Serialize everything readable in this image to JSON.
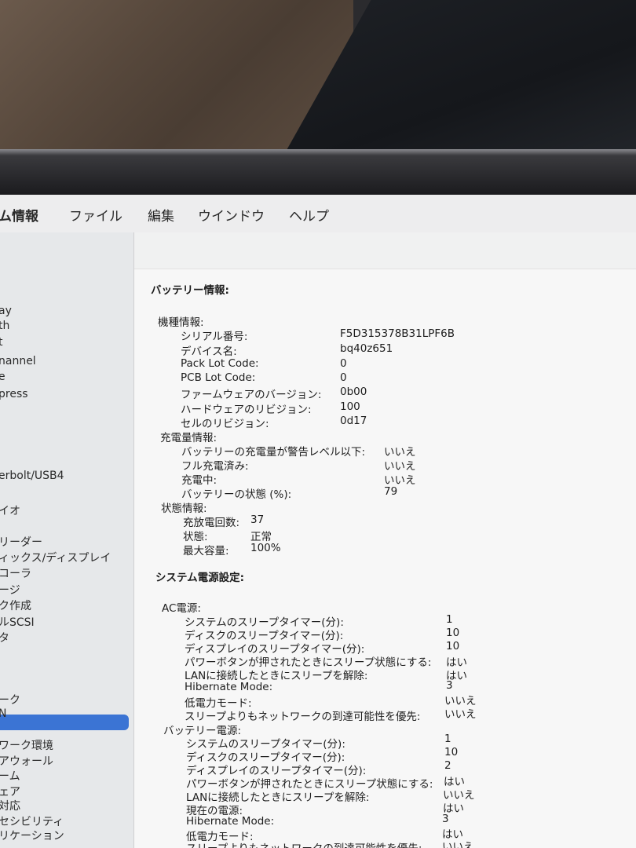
{
  "menubar": {
    "app": "ム情報",
    "file": "ファイル",
    "edit": "編集",
    "window": "ウインドウ",
    "help": "ヘルプ"
  },
  "sidebar": {
    "items": [
      "ay",
      "th",
      "t",
      "nannel",
      "e",
      "press",
      "erbolt/USB4",
      "イオ",
      "リーダー",
      "ィックス/ディスプレイ",
      "コーラ",
      "ージ",
      "ク作成",
      "ルSCSI",
      "タ",
      "ーク",
      "N",
      "ワーク環境",
      "アウォール",
      "ーム",
      "ェア",
      "対応",
      "セシビリティ",
      "リケーション"
    ]
  },
  "battery": {
    "title": "バッテリー情報:",
    "model_header": "機種情報:",
    "serial_label": "シリアル番号:",
    "serial_value": "F5D315378B31LPF6B",
    "device_label": "デバイス名:",
    "device_value": "bq40z651",
    "pack_lot_label": "Pack Lot Code:",
    "pack_lot_value": "0",
    "pcb_lot_label": "PCB Lot Code:",
    "pcb_lot_value": "0",
    "firmware_label": "ファームウェアのバージョン:",
    "firmware_value": "0b00",
    "hardware_label": "ハードウェアのリビジョン:",
    "hardware_value": "100",
    "cell_label": "セルのリビジョン:",
    "cell_value": "0d17",
    "charge_header": "充電量情報:",
    "low_label": "バッテリーの充電量が警告レベル以下:",
    "low_value": "いいえ",
    "full_label": "フル充電済み:",
    "full_value": "いいえ",
    "charging_label": "充電中:",
    "charging_value": "いいえ",
    "state_pct_label": "バッテリーの状態 (%):",
    "state_pct_value": "79",
    "status_header": "状態情報:",
    "cycle_label": "充放電回数:",
    "cycle_value": "37",
    "condition_label": "状態:",
    "condition_value": "正常",
    "max_label": "最大容量:",
    "max_value": "100%"
  },
  "power": {
    "title": "システム電源設定:",
    "ac_header": "AC電源:",
    "battery_header": "バッテリー電源:",
    "labels": {
      "sys_sleep": "システムのスリープタイマー(分):",
      "disk_sleep": "ディスクのスリープタイマー(分):",
      "display_sleep": "ディスプレイのスリープタイマー(分):",
      "power_button": "パワーボタンが押されたときにスリープ状態にする:",
      "lan_wake": "LANに接続したときにスリープを解除:",
      "current_source": "現在の電源:",
      "hibernate": "Hibernate Mode:",
      "low_power": "低電力モード:",
      "network_priority": "スリープよりもネットワークの到達可能性を優先:"
    },
    "ac": {
      "sys_sleep": "1",
      "disk_sleep": "10",
      "display_sleep": "10",
      "power_button": "はい",
      "lan_wake": "はい",
      "hibernate": "3",
      "low_power": "いいえ",
      "network_priority": "いいえ"
    },
    "bat": {
      "sys_sleep": "1",
      "disk_sleep": "10",
      "display_sleep": "2",
      "power_button": "はい",
      "lan_wake": "いいえ",
      "current_source": "はい",
      "hibernate": "3",
      "low_power": "はい",
      "network_priority": "いいえ"
    }
  }
}
